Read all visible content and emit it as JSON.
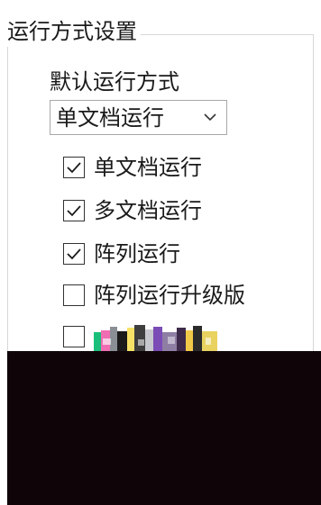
{
  "settings": {
    "group_title": "运行方式设置",
    "default_label": "默认运行方式",
    "default_select": {
      "value": "单文档运行"
    },
    "options": [
      {
        "label": "单文档运行",
        "checked": true
      },
      {
        "label": "多文档运行",
        "checked": true
      },
      {
        "label": "阵列运行",
        "checked": true
      },
      {
        "label": "阵列运行升级版",
        "checked": false
      },
      {
        "label": "",
        "checked": false
      }
    ]
  }
}
